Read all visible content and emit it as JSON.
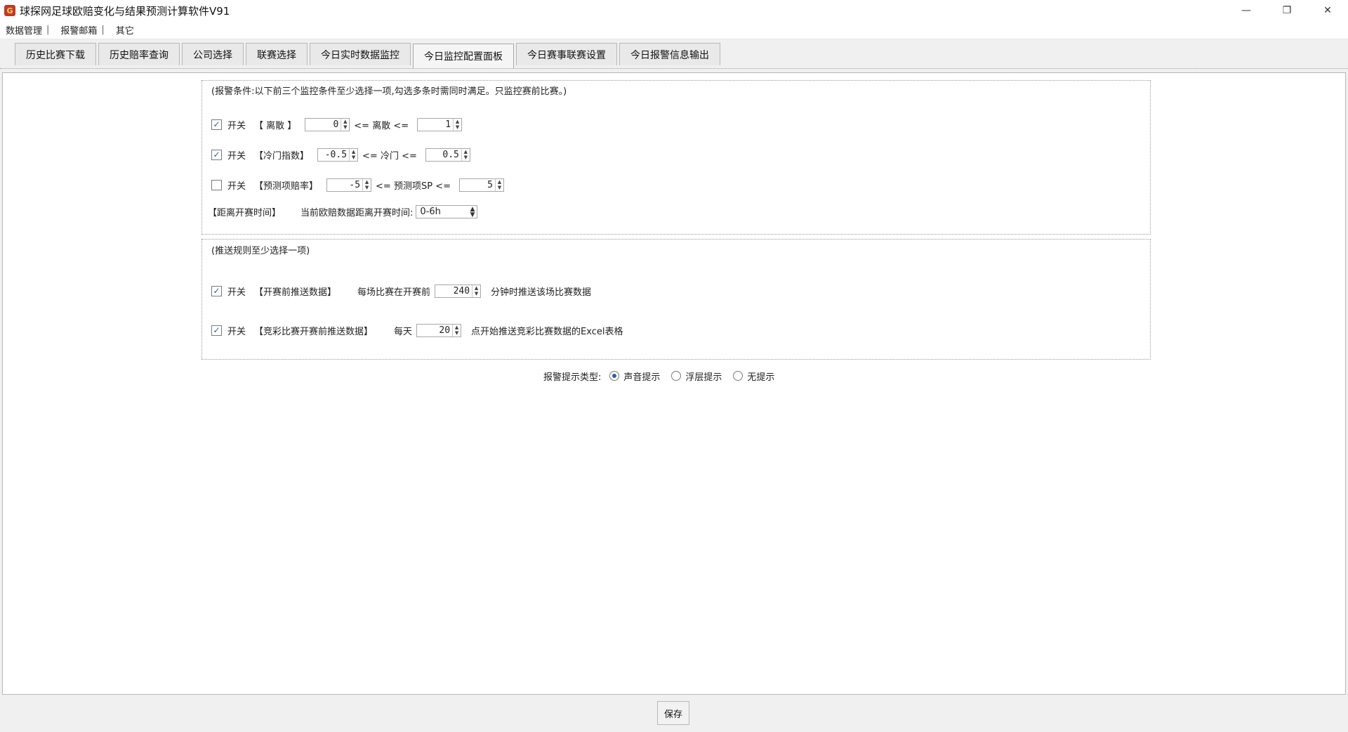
{
  "window": {
    "title": "球探网足球欧赔变化与结果预测计算软件V91",
    "controls": {
      "minimize": "—",
      "restore": "❐",
      "close": "✕"
    }
  },
  "menu": {
    "items": [
      "数据管理",
      "报警邮箱",
      "其它"
    ],
    "separator": "|"
  },
  "tabs": [
    {
      "label": "历史比赛下载",
      "active": false
    },
    {
      "label": "历史赔率查询",
      "active": false
    },
    {
      "label": "公司选择",
      "active": false
    },
    {
      "label": "联赛选择",
      "active": false
    },
    {
      "label": "今日实时数据监控",
      "active": false
    },
    {
      "label": "今日监控配置面板",
      "active": true
    },
    {
      "label": "今日赛事联赛设置",
      "active": false
    },
    {
      "label": "今日报警信息输出",
      "active": false
    }
  ],
  "alert_conditions": {
    "hint": "(报警条件:以下前三个监控条件至少选择一项,勾选多条时需同时满足。只监控赛前比赛。)",
    "switch_label": "开关",
    "rows": [
      {
        "checked": true,
        "name": "【  离散  】",
        "min": "0",
        "mid": "<= 离散 <=",
        "max": "1"
      },
      {
        "checked": true,
        "name": "【冷门指数】",
        "min": "-0.5",
        "mid": "<= 冷门 <=",
        "max": "0.5"
      },
      {
        "checked": false,
        "name": "【预测项赔率】",
        "min": "-5",
        "mid": "<= 预测项SP <=",
        "max": "5"
      }
    ],
    "time_row": {
      "label": "【距离开赛时间】",
      "desc": "当前欧赔数据距离开赛时间:",
      "value": "0-6h"
    }
  },
  "push_rules": {
    "hint": "(推送规则至少选择一项)",
    "switch_label": "开关",
    "rows": [
      {
        "checked": true,
        "name": "【开赛前推送数据】",
        "prefix": "每场比赛在开赛前",
        "value": "240",
        "suffix": "分钟时推送该场比赛数据"
      },
      {
        "checked": true,
        "name": "【竞彩比赛开赛前推送数据】",
        "prefix": "每天",
        "value": "20",
        "suffix": "点开始推送竞彩比赛数据的Excel表格"
      }
    ]
  },
  "alert_type": {
    "label": "报警提示类型:",
    "options": [
      {
        "label": "声音提示",
        "selected": true
      },
      {
        "label": "浮层提示",
        "selected": false
      },
      {
        "label": "无提示",
        "selected": false
      }
    ]
  },
  "save_label": "保存",
  "colors": {
    "accent": "#2b5fa8",
    "app_icon": "#c0392b"
  }
}
